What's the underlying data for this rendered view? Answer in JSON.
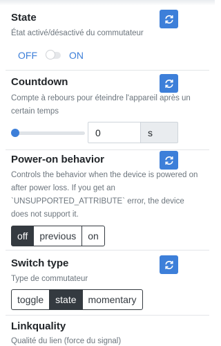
{
  "state": {
    "title": "State",
    "description": "État activé/désactivé du commutateur",
    "off_label": "OFF",
    "on_label": "ON"
  },
  "countdown": {
    "title": "Countdown",
    "description": "Compte à rebours pour éteindre l'appareil après un certain temps",
    "value": "0",
    "unit": "s",
    "slider_fraction": 0
  },
  "power_on": {
    "title": "Power-on behavior",
    "description": "Controls the behavior when the device is powered on after power loss. If you get an `UNSUPPORTED_ATTRIBUTE` error, the device does not support it.",
    "options": [
      "off",
      "previous",
      "on"
    ],
    "selected": "off"
  },
  "switch_type": {
    "title": "Switch type",
    "description": "Type de commutateur",
    "options": [
      "toggle",
      "state",
      "momentary"
    ],
    "selected": "state"
  },
  "linkquality": {
    "title": "Linkquality",
    "description": "Qualité du lien (force du signal)"
  },
  "colors": {
    "accent": "#3d7fd9",
    "dark_button": "#343a40",
    "muted_text": "#6c757d"
  },
  "icons": {
    "refresh": "refresh-icon"
  }
}
